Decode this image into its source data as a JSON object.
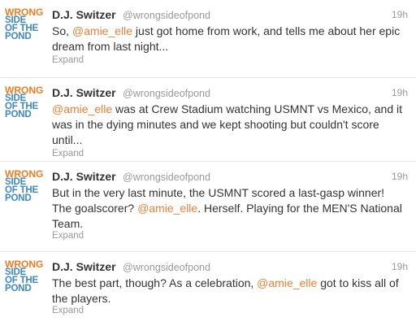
{
  "tweets": [
    {
      "avatar": {
        "line1": "WRONG",
        "line2": "SIDE",
        "line3": "OF THE",
        "line4": "POND"
      },
      "name": "D.J. Switzer",
      "handle": "@wrongsideofpond",
      "time": "19h",
      "text_parts": [
        {
          "text": "So, ",
          "type": "text"
        },
        {
          "text": "@amie_elle",
          "type": "mention"
        },
        {
          "text": " just got home from work, and tells me about her epic dream from last night...",
          "type": "text"
        }
      ],
      "expand": "Expand"
    },
    {
      "avatar": {
        "line1": "WRONG",
        "line2": "SIDE",
        "line3": "OF THE",
        "line4": "POND"
      },
      "name": "D.J. Switzer",
      "handle": "@wrongsideofpond",
      "time": "19h",
      "text_parts": [
        {
          "text": "@amie_elle",
          "type": "mention"
        },
        {
          "text": " was at Crew Stadium watching USMNT vs Mexico, and it was in the dying minutes and we kept shooting but couldn't score until...",
          "type": "text"
        }
      ],
      "expand": "Expand"
    },
    {
      "avatar": {
        "line1": "WRONG",
        "line2": "SIDE",
        "line3": "OF THE",
        "line4": "POND"
      },
      "name": "D.J. Switzer",
      "handle": "@wrongsideofpond",
      "time": "19h",
      "text_parts": [
        {
          "text": "But in the very last minute, the USMNT scored a last-gasp winner! The goalscorer? ",
          "type": "text"
        },
        {
          "text": "@amie_elle",
          "type": "mention"
        },
        {
          "text": ". Herself. Playing for the MEN'S National Team.",
          "type": "text"
        }
      ],
      "expand": "Expand"
    },
    {
      "avatar": {
        "line1": "WRONG",
        "line2": "SIDE",
        "line3": "OF THE",
        "line4": "POND"
      },
      "name": "D.J. Switzer",
      "handle": "@wrongsideofpond",
      "time": "19h",
      "text_parts": [
        {
          "text": "The best part, though? As a celebration, ",
          "type": "text"
        },
        {
          "text": "@amie_elle",
          "type": "mention"
        },
        {
          "text": " got to kiss all of the players.",
          "type": "text"
        }
      ],
      "expand": "Expand"
    }
  ],
  "colors": {
    "mention": "#e8813a",
    "avatar_orange": "#f07c22",
    "avatar_blue": "#3f88c5",
    "muted": "#999999",
    "text": "#333333"
  }
}
